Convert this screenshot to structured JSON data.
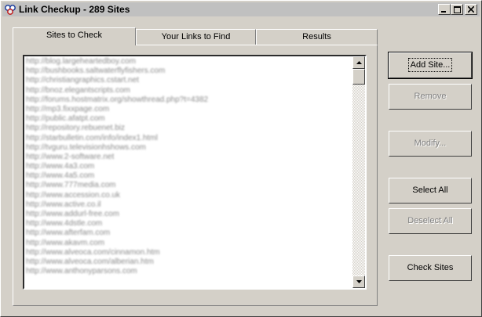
{
  "window": {
    "title": "Link Checkup - 289 Sites"
  },
  "tabs": [
    {
      "label": "Sites to Check",
      "active": true
    },
    {
      "label": "Your Links to Find",
      "active": false
    },
    {
      "label": "Results",
      "active": false
    }
  ],
  "sites": [
    "http://blog.largeheartedboy.com",
    "http://bushbooks.saltwaterflyfishers.com",
    "http://christiangraphics.cstart.net",
    "http://bnoz.elegantscripts.com",
    "http://forums.hostmatrix.org/showthread.php?t=4382",
    "http://mp3.fixxpage.com",
    "http://public.afatpt.com",
    "http://repository.rebuenet.biz",
    "http://starbulletin.com/info/index1.html",
    "http://tvguru.televisionhshows.com",
    "http://www.2-software.net",
    "http://www.4a3.com",
    "http://www.4a5.com",
    "http://www.777media.com",
    "http://www.accession.co.uk",
    "http://www.active.co.il",
    "http://www.addurl-free.com",
    "http://www.4dstle.com",
    "http://www.afterfam.com",
    "http://www.akavm.com",
    "http://www.alveoca.com/cinnamon.htm",
    "http://www.alveoca.com/alberian.htm",
    "http://www.anthonyparsons.com"
  ],
  "buttons": {
    "add_site": "Add Site...",
    "remove": "Remove",
    "modify": "Modify...",
    "select_all": "Select All",
    "deselect_all": "Deselect All",
    "check_sites": "Check Sites"
  },
  "icons": {
    "app": "link-checkup-app-icon",
    "minimize": "minimize-icon",
    "maximize": "maximize-icon",
    "close": "close-icon",
    "scroll_up": "arrow-up-icon",
    "scroll_down": "arrow-down-icon"
  }
}
